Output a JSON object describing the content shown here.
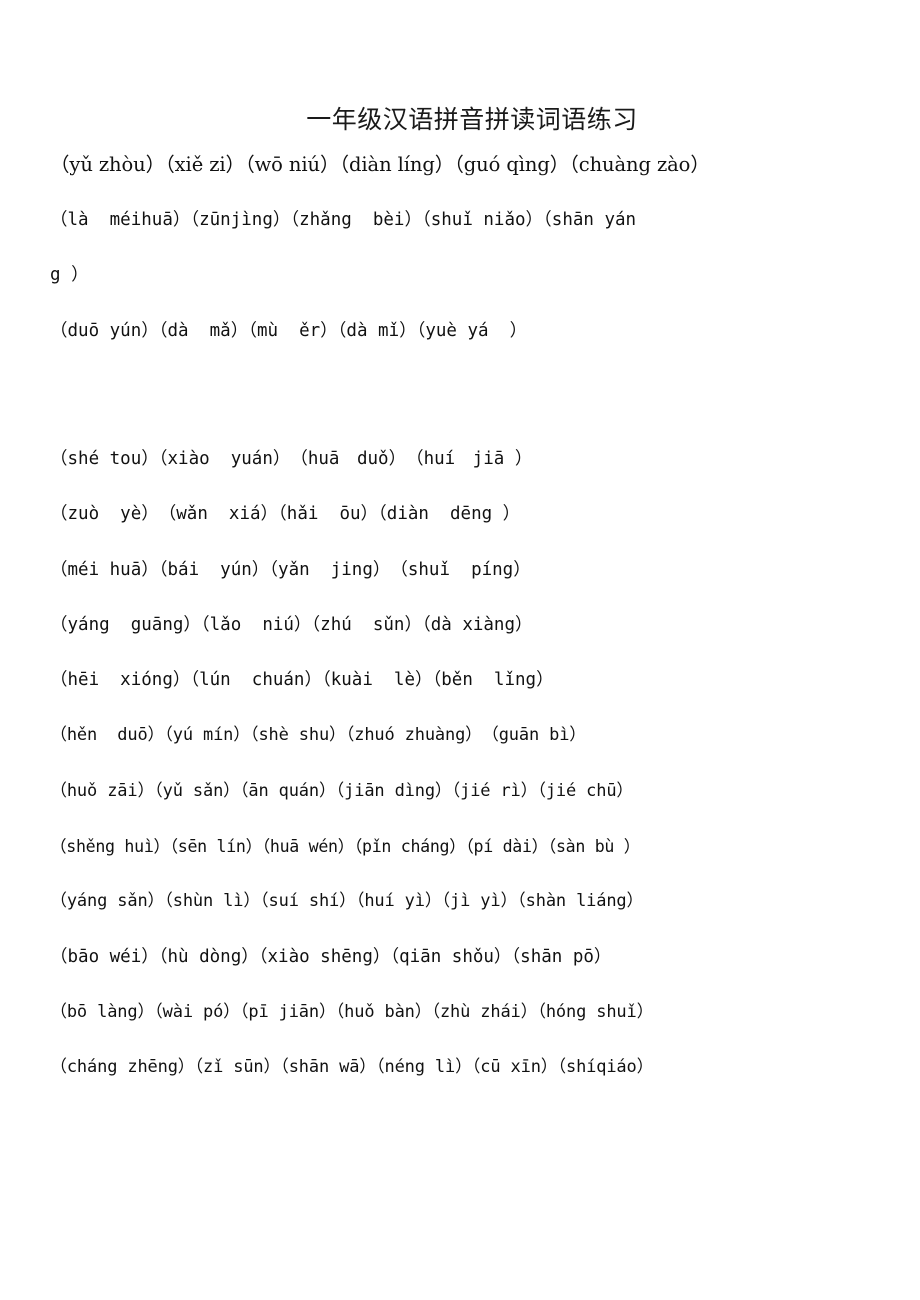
{
  "document": {
    "title": "一年级汉语拼音拼读词语练习",
    "group_a_lines": [
      "（yǔ zhòu）（xiě zi）（wō niú）（diàn líng）（guó qìng）（chuàng zào）",
      "（là  méihuā）（zūnjìng）（zhǎng  bèi）（shuǐ niǎo）（shān yán",
      "g ）",
      "（duō yún）（dà  mǎ）（mù  ěr）（dà mǐ）（yuè yá  ）"
    ],
    "group_b_lines": [
      "（shé tou）（xiào  yuán）　（huā　duǒ）　（huí　jiā ）",
      "（zuò  yè）　（wǎn  xiá）（hǎi  ōu）（diàn  dēng ）",
      "（méi huā）（bái  yún）（yǎn  jing）　（shuǐ  píng）",
      "（yáng  guāng）（lǎo  niú）（zhú  sǔn）（dà xiàng）",
      "（hēi  xióng）（lún  chuán）（kuài  lè）（běn  lǐng）",
      "（hěn  duō）（yú mín）（shè shu）（zhuó zhuàng）　（guān bì）",
      "（huǒ zāi）（yǔ sǎn）（ān quán）（jiān dìng）（jié rì）（jié chū）",
      "（shěng huì）（sēn lín）（huā wén）（pǐn cháng）（pí dài）（sàn bù ）",
      "（yáng sǎn）（shùn lì）（suí shí）（huí yì）（jì yì）（shàn liáng）",
      "（bāo wéi）（hù dòng）（xiào shēng）（qiān shǒu）（shān pō）",
      "（bō làng）（wài pó）（pī jiān）（huǒ bàn）（zhù zhái）（hóng shuǐ）",
      "（cháng zhēng）（zǐ sūn）（shān wā）（néng lì）（cū xīn）（shíqiáo）"
    ]
  }
}
